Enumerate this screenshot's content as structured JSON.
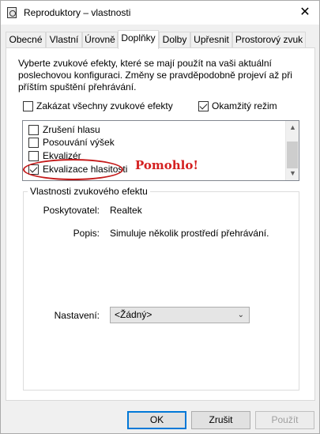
{
  "window": {
    "title": "Reproduktory – vlastnosti",
    "close_glyph": "✕"
  },
  "tabs": [
    {
      "label": "Obecné"
    },
    {
      "label": "Vlastní"
    },
    {
      "label": "Úrovně"
    },
    {
      "label": "Doplňky",
      "active": true
    },
    {
      "label": "Dolby"
    },
    {
      "label": "Upřesnit"
    },
    {
      "label": "Prostorový zvuk"
    }
  ],
  "enhancements": {
    "description": "Vyberte zvukové efekty, které se mají použít na vaši aktuální poslechovou konfiguraci. Změny se pravděpodobně projeví až při příštím spuštění přehrávání.",
    "disable_all": {
      "label": "Zakázat všechny zvukové efekty",
      "checked": false
    },
    "immediate_mode": {
      "label": "Okamžitý režim",
      "checked": true
    },
    "items": [
      {
        "label": "Zrušení hlasu",
        "checked": false
      },
      {
        "label": "Posouvání výšek",
        "checked": false
      },
      {
        "label": "Ekvalizér",
        "checked": false
      },
      {
        "label": "Ekvalizace hlasitosti",
        "checked": true
      }
    ],
    "annotation": "Pomohlo!",
    "annotation_color": "#d42020"
  },
  "properties": {
    "group_title": "Vlastnosti zvukového efektu",
    "provider_label": "Poskytovatel:",
    "provider_value": "Realtek",
    "description_label": "Popis:",
    "description_value": "Simuluje několik prostředí přehrávání.",
    "settings_label": "Nastavení:",
    "settings_value": "<Žádný>"
  },
  "buttons": {
    "ok": "OK",
    "cancel": "Zrušit",
    "apply": "Použít"
  },
  "colors": {
    "accent": "#0078d7"
  }
}
